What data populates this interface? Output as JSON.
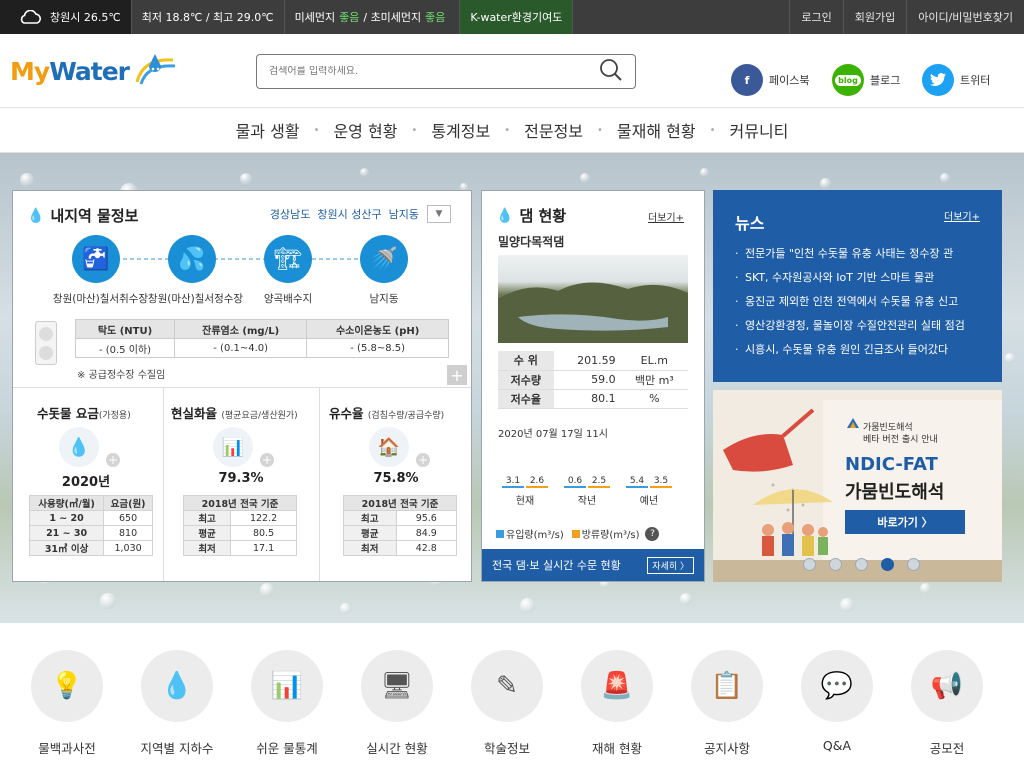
{
  "topbar": {
    "weather_city": "창원시",
    "weather_temp": "26.5℃",
    "temp_range": "최저 18.8℃ / 최고 29.0℃",
    "dust_label1": "미세먼지",
    "dust_val1": "좋음",
    "dust_sep": "/",
    "dust_label2": "초미세먼지",
    "dust_val2": "좋음",
    "kwater": "K-water환경기여도",
    "login": "로그인",
    "signup": "회원가입",
    "find_account": "아이디/비밀번호찾기"
  },
  "header": {
    "logo_my": "My",
    "logo_water": "Water",
    "search_placeholder": "검색어를 입력하세요.",
    "facebook": "페이스북",
    "blog": "블로그",
    "blog_icon_text": "blog",
    "twitter": "트위터"
  },
  "nav": [
    "물과 생활",
    "운영 현황",
    "통계정보",
    "전문정보",
    "물재해 현황",
    "커뮤니티"
  ],
  "local": {
    "title": "내지역 물정보",
    "loc1": "경상남도",
    "loc2": "창원시 성산구",
    "loc3": "남지동",
    "steps": [
      {
        "label": "창원(마산)칠서취수장"
      },
      {
        "label": "창원(마산)칠서정수장"
      },
      {
        "label": "양곡배수지"
      },
      {
        "label": "남지동"
      }
    ],
    "quality_headers": [
      "탁도 (NTU)",
      "잔류염소 (mg/L)",
      "수소이온농도 (pH)"
    ],
    "quality_values": [
      "- (0.5 이하)",
      "- (0.1~4.0)",
      "- (5.8~8.5)"
    ],
    "note": "※ 공급정수장 수질임",
    "fee_title": "수돗물 요금",
    "fee_sub": "(가정용)",
    "fee_year": "2020년",
    "fee_headers": [
      "사용량(㎥/월)",
      "요금(원)"
    ],
    "fee_rows": [
      [
        "1 ~ 20",
        "650"
      ],
      [
        "21 ~ 30",
        "810"
      ],
      [
        "31㎥ 이상",
        "1,030"
      ]
    ],
    "real_title": "현실화율",
    "real_sub": "(평균요금/생산원가)",
    "real_val": "79.3%",
    "real_header": "2018년 전국 기준",
    "real_rows": [
      [
        "최고",
        "122.2"
      ],
      [
        "평균",
        "80.5"
      ],
      [
        "최저",
        "17.1"
      ]
    ],
    "flow_title": "유수율",
    "flow_sub": "(검침수량/공급수량)",
    "flow_val": "75.8%",
    "flow_header": "2018년 전국 기준",
    "flow_rows": [
      [
        "최고",
        "95.6"
      ],
      [
        "평균",
        "84.9"
      ],
      [
        "최저",
        "42.8"
      ]
    ]
  },
  "dam": {
    "title": "댐 현황",
    "more": "더보기+",
    "name": "밀양다목적댐",
    "rows": [
      [
        "수 위",
        "201.59",
        "EL.m"
      ],
      [
        "저수량",
        "59.0",
        "백만 m³"
      ],
      [
        "저수율",
        "80.1",
        "%"
      ]
    ],
    "date": "2020년 07월 17일 11시",
    "bars": [
      {
        "in": "3.1",
        "out": "2.6",
        "label": "현재"
      },
      {
        "in": "0.6",
        "out": "2.5",
        "label": "작년"
      },
      {
        "in": "5.4",
        "out": "3.5",
        "label": "예년"
      }
    ],
    "legend_in": "유입량(m³/s)",
    "legend_out": "방류량(m³/s)",
    "help": "?",
    "footer": "전국 댐·보 실시간 수문 현황",
    "footer_btn": "자세히 〉",
    "colors": {
      "in": "#3a9be0",
      "out": "#f5a01a"
    }
  },
  "news": {
    "title": "뉴스",
    "more": "더보기+",
    "items": [
      "전문가들 \"인천 수돗물 유충 사태는 정수장 관",
      "SKT, 수자원공사와 IoT 기반 스마트 물관",
      "옹진군 제외한 인천 전역에서 수돗물 유충 신고",
      "영산강환경청, 물놀이장 수질안전관리 실태 점검",
      "시흥시, 수돗물 유충 원인 긴급조사 들어갔다"
    ]
  },
  "banner": {
    "line1": "가뭄빈도해석",
    "line2": "베타 버전 출시 안내",
    "title1": "NDIC-FAT",
    "title2": "가뭄빈도해석",
    "button": "바로가기 〉",
    "active_dot": 4
  },
  "bottom": [
    {
      "label": "물백과사전",
      "icon": "lightbulb-icon",
      "glyph": "💡"
    },
    {
      "label": "지역별 지하수",
      "icon": "water-drop-icon",
      "glyph": "💧"
    },
    {
      "label": "쉬운 물통계",
      "icon": "chart-board-icon",
      "glyph": "📊"
    },
    {
      "label": "실시간 현황",
      "icon": "monitor-icon",
      "glyph": "🖥"
    },
    {
      "label": "학술정보",
      "icon": "pencil-icon",
      "glyph": "✎"
    },
    {
      "label": "재해 현황",
      "icon": "siren-icon",
      "glyph": "🚨"
    },
    {
      "label": "공지사항",
      "icon": "notice-board-icon",
      "glyph": "📋"
    },
    {
      "label": "Q&A",
      "icon": "chat-bubble-icon",
      "glyph": "💬"
    },
    {
      "label": "공모전",
      "icon": "megaphone-icon",
      "glyph": "📢"
    }
  ]
}
